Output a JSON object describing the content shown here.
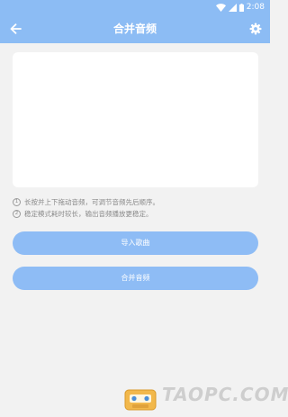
{
  "status_bar": {
    "time": "2:08"
  },
  "header": {
    "title": "合并音频",
    "back_icon": "arrow-left-icon",
    "settings_icon": "gear-icon"
  },
  "tips": [
    {
      "num": "1",
      "text": "长按并上下拖动音频，可调节音频先后顺序。"
    },
    {
      "num": "2",
      "text": "稳定模式耗时较长，输出音频播放更稳定。"
    }
  ],
  "buttons": {
    "import_label": "导入歌曲",
    "merge_label": "合并音频"
  },
  "watermark": {
    "text": "TAOPC.COM"
  },
  "colors": {
    "primary": "#8cbcf4",
    "background": "#f2f2f2",
    "card": "#ffffff",
    "tip_text": "#8a8a8a"
  }
}
